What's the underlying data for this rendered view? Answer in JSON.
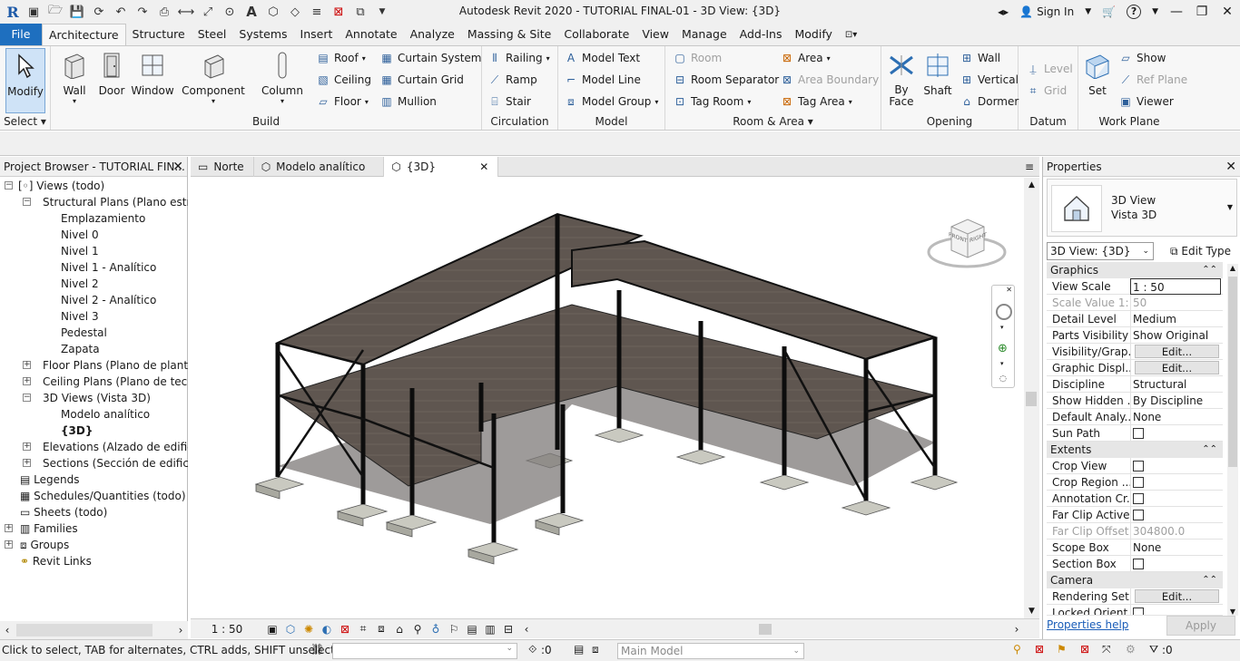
{
  "window": {
    "title": "Autodesk Revit 2020 - TUTORIAL FINAL-01 - 3D View: {3D}",
    "sign_in": "Sign In"
  },
  "menu_tabs": [
    "File",
    "Architecture",
    "Structure",
    "Steel",
    "Systems",
    "Insert",
    "Annotate",
    "Analyze",
    "Massing & Site",
    "Collaborate",
    "View",
    "Manage",
    "Add-Ins",
    "Modify"
  ],
  "ribbon": {
    "select": {
      "modify": "Modify",
      "label": "Select"
    },
    "build": {
      "label": "Build",
      "wall": "Wall",
      "door": "Door",
      "window": "Window",
      "component": "Component",
      "column": "Column",
      "roof": "Roof",
      "ceiling": "Ceiling",
      "floor": "Floor",
      "curtain_system": "Curtain System",
      "curtain_grid": "Curtain Grid",
      "mullion": "Mullion"
    },
    "circulation": {
      "label": "Circulation",
      "railing": "Railing",
      "ramp": "Ramp",
      "stair": "Stair"
    },
    "model": {
      "label": "Model",
      "model_text": "Model Text",
      "model_line": "Model Line",
      "model_group": "Model Group"
    },
    "room_area": {
      "label": "Room & Area",
      "room": "Room",
      "room_separator": "Room Separator",
      "tag_room": "Tag Room",
      "area": "Area",
      "area_boundary": "Area Boundary",
      "tag_area": "Tag Area"
    },
    "opening": {
      "label": "Opening",
      "by_face": "By Face",
      "shaft": "Shaft",
      "wall": "Wall",
      "vertical": "Vertical",
      "dormer": "Dormer"
    },
    "datum": {
      "label": "Datum",
      "level": "Level",
      "grid": "Grid"
    },
    "work_plane": {
      "label": "Work Plane",
      "set": "Set",
      "show": "Show",
      "ref_plane": "Ref Plane",
      "viewer": "Viewer"
    }
  },
  "project_browser": {
    "title": "Project Browser - TUTORIAL FIN...",
    "nodes": [
      {
        "label": "Views (todo)"
      },
      {
        "label": "Structural Plans (Plano estruct"
      },
      {
        "label": "Emplazamiento"
      },
      {
        "label": "Nivel 0"
      },
      {
        "label": "Nivel 1"
      },
      {
        "label": "Nivel 1 - Analítico"
      },
      {
        "label": "Nivel 2"
      },
      {
        "label": "Nivel 2 - Analítico"
      },
      {
        "label": "Nivel 3"
      },
      {
        "label": "Pedestal"
      },
      {
        "label": "Zapata"
      },
      {
        "label": "Floor Plans (Plano de planta)"
      },
      {
        "label": "Ceiling Plans (Plano de techo"
      },
      {
        "label": "3D Views (Vista 3D)"
      },
      {
        "label": "Modelo analítico"
      },
      {
        "label": "{3D}"
      },
      {
        "label": "Elevations (Alzado de edificio"
      },
      {
        "label": "Sections (Sección de edificio)"
      },
      {
        "label": "Legends"
      },
      {
        "label": "Schedules/Quantities (todo)"
      },
      {
        "label": "Sheets (todo)"
      },
      {
        "label": "Families"
      },
      {
        "label": "Groups"
      },
      {
        "label": "Revit Links"
      }
    ]
  },
  "view_tabs": [
    "Norte",
    "Modelo analítico",
    "{3D}"
  ],
  "viewcube": {
    "front": "FRONT",
    "right": "RIGHT"
  },
  "view_bar": {
    "scale": "1 : 50"
  },
  "properties": {
    "title": "Properties",
    "type_line1": "3D View",
    "type_line2": "Vista 3D",
    "selector": "3D View: {3D}",
    "edit_type": "Edit Type",
    "sections": {
      "graphics": "Graphics",
      "extents": "Extents",
      "camera": "Camera"
    },
    "rows": {
      "view_scale": {
        "k": "View Scale",
        "v": "1 : 50"
      },
      "scale_value": {
        "k": "Scale Value    1:",
        "v": "50"
      },
      "detail_level": {
        "k": "Detail Level",
        "v": "Medium"
      },
      "parts_visibility": {
        "k": "Parts Visibility",
        "v": "Show Original"
      },
      "visibility_graphics": {
        "k": "Visibility/Grap...",
        "v": "Edit..."
      },
      "graphic_display": {
        "k": "Graphic Displ...",
        "v": "Edit..."
      },
      "discipline": {
        "k": "Discipline",
        "v": "Structural"
      },
      "show_hidden": {
        "k": "Show Hidden ...",
        "v": "By Discipline"
      },
      "default_analysis": {
        "k": "Default Analy...",
        "v": "None"
      },
      "sun_path": {
        "k": "Sun Path",
        "v": ""
      },
      "crop_view": {
        "k": "Crop View",
        "v": ""
      },
      "crop_region": {
        "k": "Crop Region ...",
        "v": ""
      },
      "annotation_crop": {
        "k": "Annotation Cr...",
        "v": ""
      },
      "far_clip_active": {
        "k": "Far Clip Active",
        "v": ""
      },
      "far_clip_offset": {
        "k": "Far Clip Offset",
        "v": "304800.0"
      },
      "scope_box": {
        "k": "Scope Box",
        "v": "None"
      },
      "section_box": {
        "k": "Section Box",
        "v": ""
      },
      "rendering_settings": {
        "k": "Rendering Set...",
        "v": "Edit..."
      },
      "locked_orient": {
        "k": "Locked Orient...",
        "v": ""
      }
    },
    "help": "Properties help",
    "apply": "Apply"
  },
  "status": {
    "hint": "Click to select, TAB for alternates, CTRL adds, SHIFT unselects.",
    "count": ":0",
    "model": "Main Model",
    "filter": ":0"
  }
}
